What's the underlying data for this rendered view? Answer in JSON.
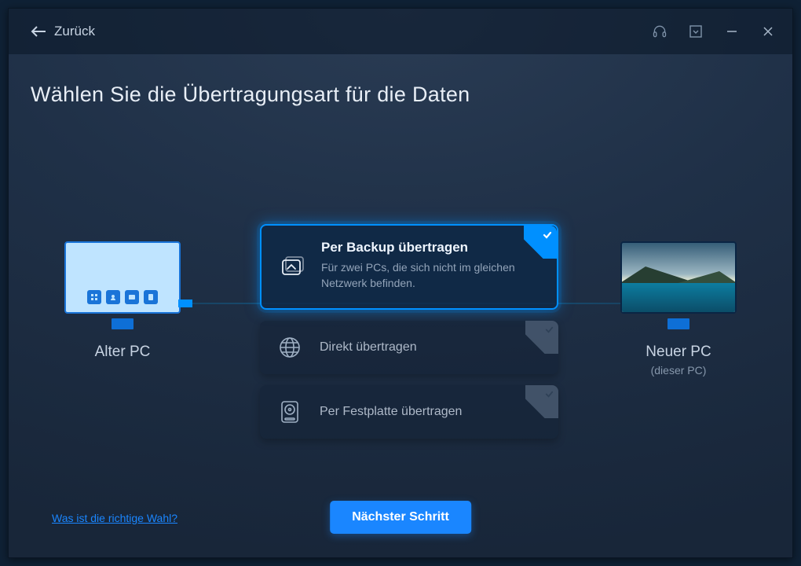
{
  "header": {
    "back_label": "Zurück"
  },
  "page": {
    "title": "Wählen Sie die Übertragungsart für die Daten"
  },
  "pc": {
    "old_label": "Alter PC",
    "new_label": "Neuer PC",
    "new_sub": "(dieser PC)"
  },
  "options": {
    "backup": {
      "title": "Per Backup übertragen",
      "desc": "Für zwei PCs, die sich nicht im gleichen Netzwerk befinden.",
      "selected": true
    },
    "direct": {
      "title": "Direkt übertragen",
      "selected": false
    },
    "disk": {
      "title": "Per Festplatte übertragen",
      "selected": false
    }
  },
  "footer": {
    "help_link": "Was ist die richtige Wahl?",
    "next_label": "Nächster Schritt"
  },
  "icons": {
    "back": "arrow-left",
    "support": "headset",
    "menu": "dropdown-box",
    "minimize": "minimize",
    "close": "close",
    "backup": "transfer-box",
    "direct": "globe",
    "disk": "hard-drive"
  }
}
